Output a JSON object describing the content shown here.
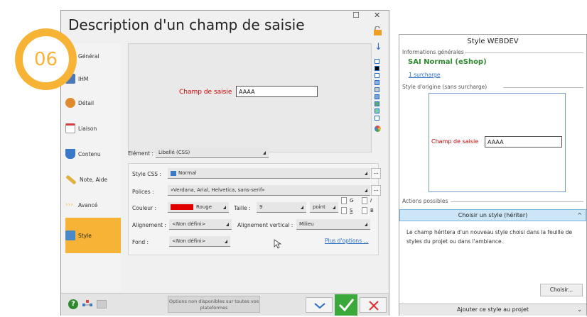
{
  "badge": {
    "number": "06"
  },
  "dialog": {
    "title": "Description d'un champ de saisie",
    "maximize_icon": "☐",
    "close_icon": "✕",
    "sidebar": [
      {
        "label": "Général",
        "icon": "general-icon",
        "color": "#6b8fbf"
      },
      {
        "label": "IHM",
        "icon": "ihm-icon",
        "color": "#4a78b8"
      },
      {
        "label": "Détail",
        "icon": "detail-icon",
        "color": "#e08a2e"
      },
      {
        "label": "Liaison",
        "icon": "liaison-icon",
        "color": "#d04040"
      },
      {
        "label": "Contenu",
        "icon": "contenu-icon",
        "color": "#3a78c8"
      },
      {
        "label": "Note, Aide",
        "icon": "note-icon",
        "color": "#e0b040"
      },
      {
        "label": "Avancé",
        "icon": "avance-icon",
        "color": "#f0c060"
      },
      {
        "label": "Style",
        "icon": "style-icon",
        "color": "#4a88c8"
      }
    ],
    "preview": {
      "field_label": "Champ de saisie",
      "field_value": "AAAA"
    },
    "element": {
      "label": "Elément :",
      "value": "Libellé (CSS)"
    },
    "style_css": {
      "label": "Style CSS :",
      "value": "Normal",
      "ellipsis": "..."
    },
    "polices": {
      "label": "Polices :",
      "value": "«Verdana, Arial, Helvetica, sans-serif»",
      "ellipsis": "..."
    },
    "couleur": {
      "label": "Couleur :",
      "value": "Rouge",
      "swatch": "#e00000"
    },
    "taille": {
      "label": "Taille :",
      "value": "9",
      "unit": "point"
    },
    "style_buttons": [
      "G",
      "I",
      "S",
      "B"
    ],
    "alignement": {
      "label": "Alignement :",
      "value": "<Non défini>"
    },
    "alignement_vertical": {
      "label": "Alignement vertical :",
      "value": "Milieu"
    },
    "plus_options": "Plus d'options ...",
    "fond": {
      "label": "Fond :",
      "value": "<Non défini>"
    },
    "bottom_note": "Options non disponibles sur toutes vos plateformes",
    "swatch_colors": [
      "#ffffff",
      "#000000",
      "#ffffff",
      "#8ab0e0",
      "#c8c8c8",
      "#7aa0d8",
      "#5aa878",
      "#7ad0a0",
      "#ffffff"
    ]
  },
  "panel": {
    "title": "Style WEBDEV",
    "info_section": "Informations générales",
    "style_name": "SAI Normal (eShop)",
    "surcharge": "1 surcharge",
    "origin_section": "Style d'origine (sans surcharge)",
    "field_label": "Champ de saisie",
    "field_value": "AAAA",
    "actions_section": "Actions possibles",
    "action_selected": "Choisir un style (hériter)",
    "description": "Le champ héritera d'un nouveau style choisi dans la feuille de styles du projet ou dans l'ambiance.",
    "choose_button": "Choisir...",
    "add_style": "Ajouter ce style au projet"
  }
}
